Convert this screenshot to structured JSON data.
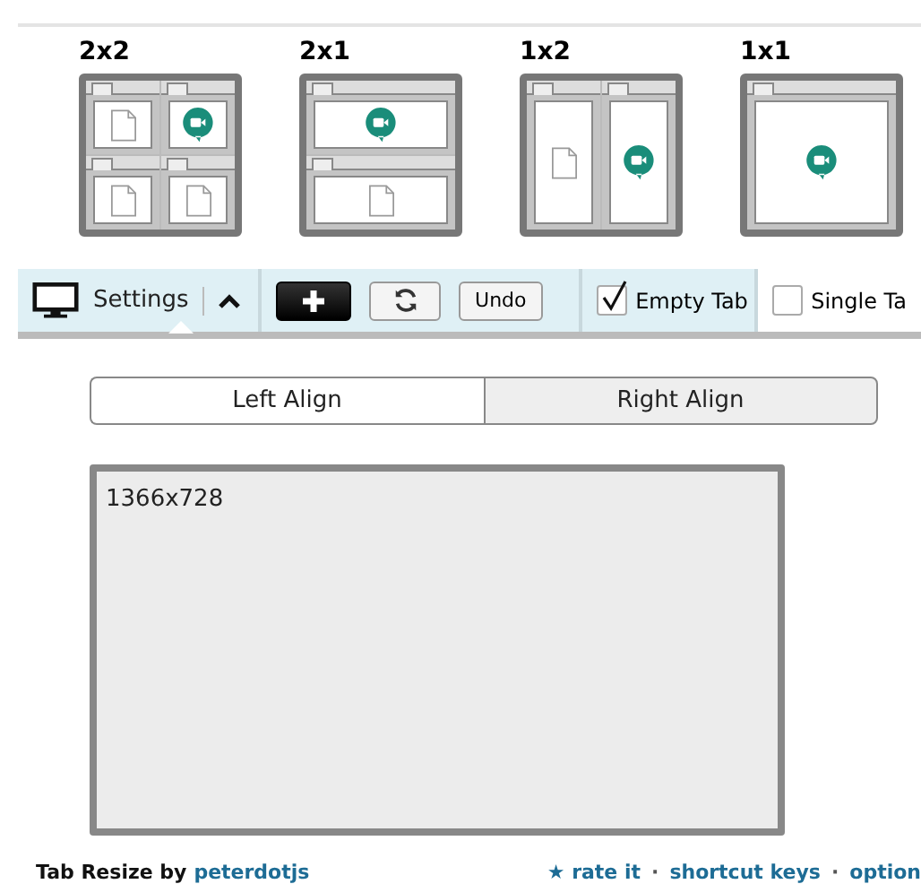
{
  "layouts": [
    {
      "label": "2x2",
      "kind": "grid",
      "panes": [
        {
          "kind": "doc"
        },
        {
          "kind": "meet"
        },
        {
          "kind": "doc"
        },
        {
          "kind": "doc"
        }
      ]
    },
    {
      "label": "2x1",
      "kind": "rows",
      "panes": [
        {
          "kind": "meet"
        },
        {
          "kind": "doc"
        }
      ]
    },
    {
      "label": "1x2",
      "kind": "columns",
      "panes": [
        {
          "kind": "doc"
        },
        {
          "kind": "meet"
        }
      ]
    },
    {
      "label": "1x1",
      "kind": "single",
      "panes": [
        {
          "kind": "meet"
        }
      ]
    }
  ],
  "toolbar": {
    "settings_label": "Settings",
    "undo_label": "Undo",
    "checkboxes": [
      {
        "label": "Empty Tab",
        "checked": true
      },
      {
        "label": "Single Ta",
        "checked": false
      }
    ]
  },
  "align": [
    {
      "label": "Left Align",
      "selected": false
    },
    {
      "label": "Right Align",
      "selected": true
    }
  ],
  "preview": {
    "resolution": "1366x728"
  },
  "footer": {
    "credit": "Tab Resize by",
    "author": "peterdotjs",
    "links": [
      "★ rate it",
      "shortcut keys",
      "option"
    ],
    "separator": "·"
  }
}
